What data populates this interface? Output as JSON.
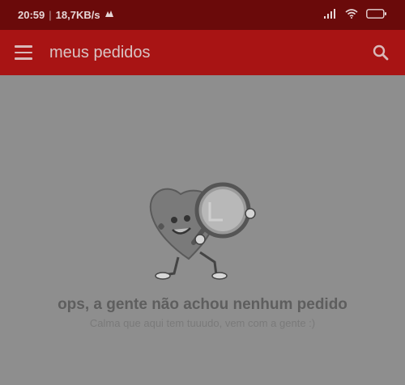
{
  "status_bar": {
    "time": "20:59",
    "speed": "18,7KB/s"
  },
  "app_bar": {
    "title": "meus pedidos",
    "menu_icon": "menu-icon",
    "search_icon": "search-icon"
  },
  "empty_state": {
    "title": "ops, a gente não achou nenhum pedido",
    "subtitle": "Calma que aqui tem tuuudo, vem com a gente :)"
  },
  "colors": {
    "status_bar": "#6a0a0a",
    "app_bar": "#a81414",
    "background": "#8e8e8e"
  }
}
